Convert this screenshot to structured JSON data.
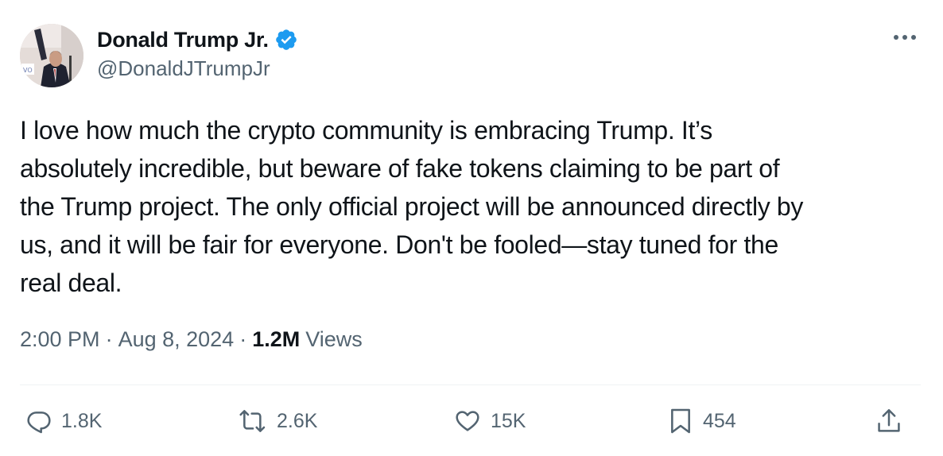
{
  "tweet": {
    "author": {
      "display_name": "Donald Trump Jr.",
      "handle": "@DonaldJTrumpJr",
      "verified_icon": "verified-badge-icon",
      "avatar_icon": "avatar-photo"
    },
    "text": "I love how much the crypto community is embracing Trump. It’s\nabsolutely incredible, but beware of fake tokens claiming to be part of\nthe Trump project. The only official project will be announced directly by\nus, and it will be fair for everyone. Don't be fooled—stay tuned for the\nreal deal.",
    "time": "2:00 PM",
    "date": "Aug 8, 2024",
    "separator": "·",
    "views_count": "1.2M",
    "views_label": "Views",
    "actions": {
      "replies": "1.8K",
      "reposts": "2.6K",
      "likes": "15K",
      "bookmarks": "454"
    }
  },
  "colors": {
    "text": "#0f1419",
    "secondary": "#536471",
    "verified": "#1d9bf0",
    "divider": "#eff3f4"
  }
}
